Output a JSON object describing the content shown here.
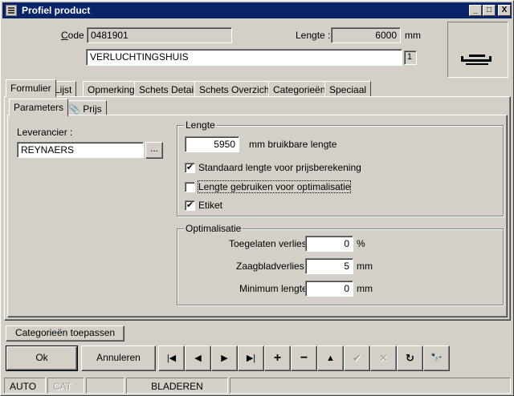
{
  "window": {
    "title": "Profiel product"
  },
  "titlebar_buttons": {
    "minimize": "_",
    "maximize": "□",
    "close": "X"
  },
  "header": {
    "code_label": "Code :",
    "code_value": "0481901",
    "lengte_label": "Lengte :",
    "lengte_value": "6000",
    "lengte_unit": "mm",
    "description": "VERLUCHTINGSHUIS",
    "description_count": "1"
  },
  "tabs": [
    "Formulier",
    "Lijst",
    "Opmerking",
    "Schets Detail",
    "Schets Overzicht",
    "Categorieën",
    "Speciaal"
  ],
  "subtabs": [
    "Parameters",
    "Prijs"
  ],
  "leverancier": {
    "label": "Leverancier :",
    "value": "REYNAERS",
    "browse": "..."
  },
  "lengte_group": {
    "title": "Lengte",
    "value": "5950",
    "unit": "mm bruikbare lengte",
    "checks": [
      {
        "label": "Standaard lengte voor prijsberekening",
        "checked": "✔"
      },
      {
        "label": "Lengte gebruiken voor optimalisatie",
        "checked": ""
      },
      {
        "label": "Etiket",
        "checked": "✔"
      }
    ]
  },
  "optimalisatie_group": {
    "title": "Optimalisatie",
    "rows": [
      {
        "label": "Toegelaten verlies :",
        "value": "0",
        "unit": "%"
      },
      {
        "label": "Zaagbladverlies :",
        "value": "5",
        "unit": "mm"
      },
      {
        "label": "Minimum lengte :",
        "value": "0",
        "unit": "mm"
      }
    ]
  },
  "buttons": {
    "categorieen": "Categorieën toepassen",
    "ok": "Ok",
    "annuleren": "Annuleren"
  },
  "nav_icons": {
    "first": "|◀",
    "prev": "◀",
    "next": "▶",
    "last": "▶|",
    "add": "+",
    "delete": "−",
    "up": "▲",
    "confirm": "✔",
    "cancel": "✕",
    "refresh": "↻",
    "find": "🔭"
  },
  "statusbar": [
    "AUTO",
    "CAT",
    "",
    "BLADEREN",
    ""
  ]
}
